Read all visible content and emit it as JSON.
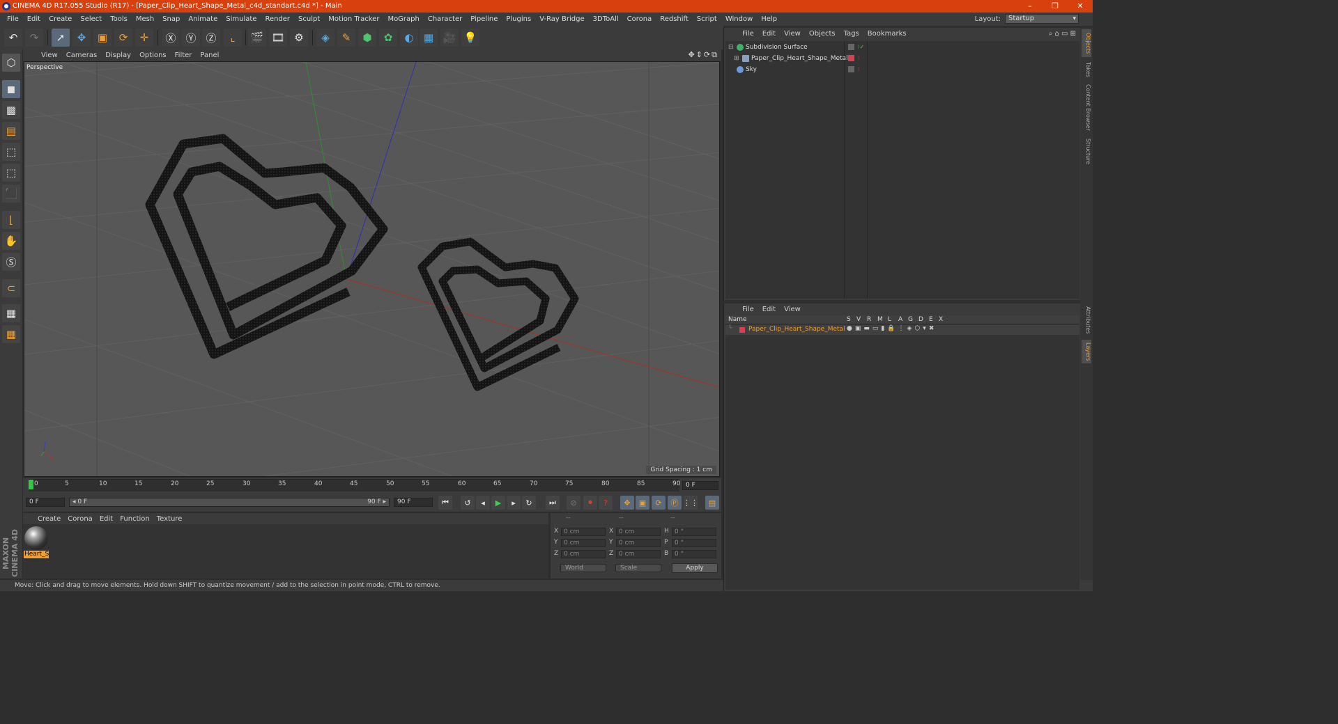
{
  "window": {
    "title": "CINEMA 4D R17.055 Studio (R17) - [Paper_Clip_Heart_Shape_Metal_c4d_standart.c4d *] - Main",
    "controls": [
      "–",
      "❐",
      "✕"
    ]
  },
  "menubar": {
    "items": [
      "File",
      "Edit",
      "Create",
      "Select",
      "Tools",
      "Mesh",
      "Snap",
      "Animate",
      "Simulate",
      "Render",
      "Sculpt",
      "Motion Tracker",
      "MoGraph",
      "Character",
      "Pipeline",
      "Plugins",
      "V-Ray Bridge",
      "3DToAll",
      "Corona",
      "Redshift",
      "Script",
      "Window",
      "Help"
    ],
    "layout_label": "Layout:",
    "layout_value": "Startup"
  },
  "viewport": {
    "menu": [
      "View",
      "Cameras",
      "Display",
      "Options",
      "Filter",
      "Panel"
    ],
    "label": "Perspective",
    "grid_spacing": "Grid Spacing : 1 cm",
    "axis_colors": {
      "x": "#c0302a",
      "y": "#3aa03a",
      "z": "#3a3ac8"
    }
  },
  "timeline": {
    "ticks": [
      "0",
      "5",
      "10",
      "15",
      "20",
      "25",
      "30",
      "35",
      "40",
      "45",
      "50",
      "55",
      "60",
      "65",
      "70",
      "75",
      "80",
      "85",
      "90"
    ],
    "current_frame_field": "0 F",
    "start_field": "0 F",
    "range_start": "◂ 0 F",
    "range_end": "90 F ▸",
    "end_field": "90 F"
  },
  "material_manager": {
    "menu": [
      "Create",
      "Corona",
      "Edit",
      "Function",
      "Texture"
    ],
    "material_name": "Heart_Sl"
  },
  "coordinates": {
    "headers": [
      "--",
      "--",
      "--"
    ],
    "rows": [
      {
        "a1": "X",
        "v1": "0 cm",
        "a2": "X",
        "v2": "0 cm",
        "a3": "H",
        "v3": "0 °"
      },
      {
        "a1": "Y",
        "v1": "0 cm",
        "a2": "Y",
        "v2": "0 cm",
        "a3": "P",
        "v3": "0 °"
      },
      {
        "a1": "Z",
        "v1": "0 cm",
        "a2": "Z",
        "v2": "0 cm",
        "a3": "B",
        "v3": "0 °"
      }
    ],
    "mode_world": "World",
    "mode_scale": "Scale",
    "apply": "Apply"
  },
  "object_manager": {
    "menu": [
      "File",
      "Edit",
      "View",
      "Objects",
      "Tags",
      "Bookmarks"
    ],
    "objects": [
      {
        "name": "Subdivision Surface",
        "icon_color": "#3fb068"
      },
      {
        "name": "Paper_Clip_Heart_Shape_Metal",
        "icon_color": "#8aa0c0"
      },
      {
        "name": "Sky",
        "icon_color": "#6a9ad8"
      }
    ]
  },
  "layer_manager": {
    "menu": [
      "File",
      "Edit",
      "View"
    ],
    "columns": [
      "Name",
      "S",
      "V",
      "R",
      "M",
      "L",
      "A",
      "G",
      "D",
      "E",
      "X"
    ],
    "layer_name": "Paper_Clip_Heart_Shape_Metal",
    "layer_color": "#d84050"
  },
  "side_tabs": [
    "Objects",
    "Takes",
    "Content Browser",
    "Structure",
    "Attributes",
    "Layers"
  ],
  "status": "Move: Click and drag to move elements. Hold down SHIFT to quantize movement / add to the selection in point mode, CTRL to remove.",
  "branding": "MAXON CINEMA 4D"
}
